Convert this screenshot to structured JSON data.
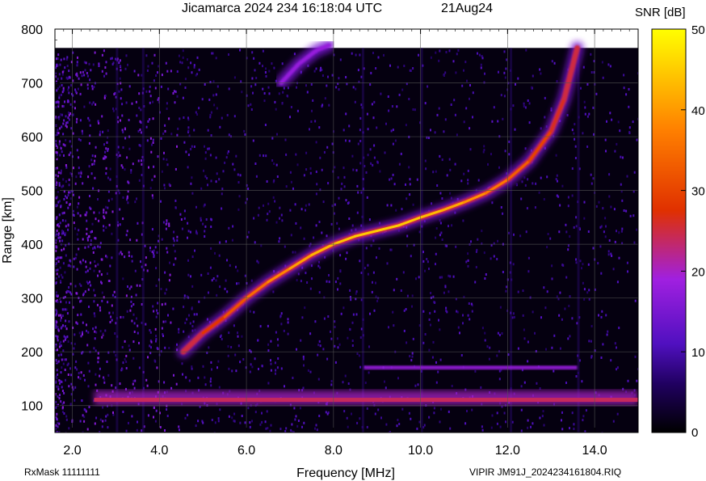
{
  "header": {
    "title": "Jicamarca 2024 234 16:18:04 UTC",
    "date": "21Aug24"
  },
  "footer": {
    "left": "RxMask 11111111",
    "right": "VIPIR  JM91J_2024234161804.RIQ"
  },
  "colorbar": {
    "label": "SNR [dB]",
    "ticks": [
      "0",
      "10",
      "20",
      "30",
      "40",
      "50"
    ],
    "range": [
      0,
      50
    ],
    "colors": [
      "#000000",
      "#5010c0",
      "#a020e0",
      "#e03000",
      "#ff8000",
      "#ffff00"
    ]
  },
  "chart_data": {
    "type": "heatmap",
    "xlabel": "Frequency [MHz]",
    "ylabel": "Range [km]",
    "xlim": [
      1.6,
      15.0
    ],
    "ylim": [
      50,
      800
    ],
    "xticks": [
      "2.0",
      "4.0",
      "6.0",
      "8.0",
      "10.0",
      "12.0",
      "14.0"
    ],
    "xtick_values": [
      2,
      4,
      6,
      8,
      10,
      12,
      14
    ],
    "yticks": [
      "100",
      "200",
      "300",
      "400",
      "500",
      "600",
      "700",
      "800"
    ],
    "ytick_values": [
      100,
      200,
      300,
      400,
      500,
      600,
      700,
      800
    ],
    "grid": true,
    "data_top_range_km": 765,
    "traces": [
      {
        "id": "o-mode-trace",
        "points": [
          [
            4.55,
            200
          ],
          [
            5.0,
            235
          ],
          [
            5.5,
            265
          ],
          [
            6.0,
            300
          ],
          [
            6.5,
            330
          ],
          [
            7.0,
            355
          ],
          [
            7.5,
            380
          ],
          [
            8.0,
            400
          ],
          [
            8.5,
            415
          ],
          [
            9.0,
            425
          ],
          [
            9.5,
            435
          ],
          [
            10.0,
            450
          ],
          [
            10.5,
            463
          ],
          [
            11.0,
            478
          ],
          [
            11.5,
            495
          ],
          [
            12.0,
            520
          ],
          [
            12.5,
            555
          ],
          [
            13.0,
            610
          ],
          [
            13.3,
            670
          ],
          [
            13.6,
            765
          ]
        ],
        "peak_snr_db": 45
      },
      {
        "id": "multi-hop-trace",
        "points": [
          [
            6.8,
            700
          ],
          [
            7.2,
            735
          ],
          [
            7.6,
            760
          ],
          [
            7.9,
            770
          ]
        ],
        "peak_snr_db": 18
      }
    ],
    "bands": [
      {
        "id": "e-region-echo",
        "freq_range": [
          2.5,
          15.0
        ],
        "range_km": 110,
        "snr_db": 20
      },
      {
        "id": "interference-line",
        "freq_range": [
          8.7,
          13.6
        ],
        "range_km": 170,
        "snr_db": 18
      }
    ]
  }
}
